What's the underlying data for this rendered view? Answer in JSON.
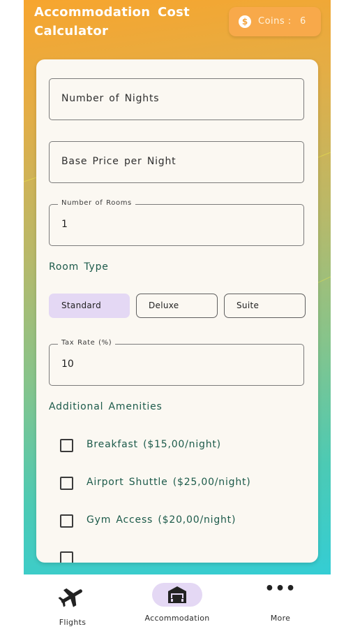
{
  "header": {
    "title": "Accommodation Cost Calculator",
    "coins_label": "Coins :",
    "coins_value": "6",
    "coin_icon": "dollar-coin-icon"
  },
  "form": {
    "nights": {
      "placeholder": "Number of Nights"
    },
    "base_price": {
      "placeholder": "Base Price per Night"
    },
    "rooms": {
      "label": "Number of Rooms",
      "value": "1"
    },
    "room_type": {
      "title": "Room Type",
      "options": [
        "Standard",
        "Deluxe",
        "Suite"
      ],
      "selected": "Standard"
    },
    "tax_rate": {
      "label": "Tax Rate (%)",
      "value": "10"
    },
    "amenities": {
      "title": "Additional Amenities",
      "items": [
        {
          "label": "Breakfast ($15,00/night)",
          "checked": false
        },
        {
          "label": "Airport Shuttle ($25,00/night)",
          "checked": false
        },
        {
          "label": "Gym Access ($20,00/night)",
          "checked": false
        }
      ]
    }
  },
  "nav": {
    "items": [
      {
        "label": "Flights",
        "icon": "airplane-icon",
        "active": false
      },
      {
        "label": "Accommodation",
        "icon": "hotel-icon",
        "active": true
      },
      {
        "label": "More",
        "icon": "more-dots-icon",
        "active": false
      }
    ]
  },
  "colors": {
    "gradient_top": "#f7a52e",
    "gradient_bottom": "#34cdd4",
    "accent": "#e4d8f4",
    "section_text": "#1c5a4a",
    "coins_badge": "#f8a94a"
  }
}
